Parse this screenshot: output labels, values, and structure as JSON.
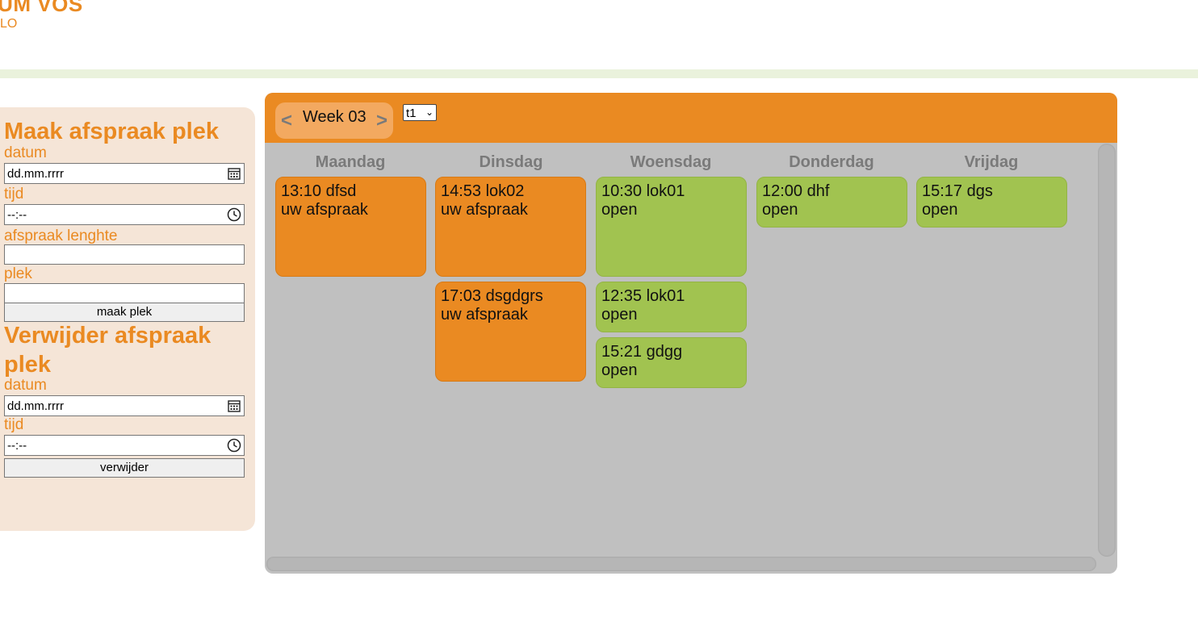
{
  "brand": {
    "title": "CEUM VOS",
    "subtitle": "LO"
  },
  "create_form": {
    "title": "Maak afspraak plek",
    "datum_label": "datum",
    "datum_value": "dd.mm.rrrr",
    "tijd_label": "tijd",
    "tijd_value": "--:--",
    "lengte_label": "afspraak lenghte",
    "lengte_value": "",
    "plek_label": "plek",
    "plek_value": "",
    "submit": "maak plek"
  },
  "delete_form": {
    "title": "Verwijder afspraak plek",
    "datum_label": "datum",
    "datum_value": "dd.mm.rrrr",
    "tijd_label": "tijd",
    "tijd_value": "--:--",
    "submit": "verwijder"
  },
  "calendar": {
    "prev": "<",
    "next": ">",
    "week": "Week 03",
    "selected": "t1",
    "days": [
      "Maandag",
      "Dinsdag",
      "Woensdag",
      "Donderdag",
      "Vrijdag"
    ],
    "appointments": [
      {
        "line1": "13:10 dfsd",
        "line2": "uw afspraak",
        "status": "mine"
      },
      {
        "line1": "14:53 lok02",
        "line2": "uw afspraak",
        "status": "mine"
      },
      {
        "line1": "17:03 dsgdgrs",
        "line2": "uw afspraak",
        "status": "mine"
      },
      {
        "line1": "10:30 lok01",
        "line2": "open",
        "status": "open"
      },
      {
        "line1": "12:35 lok01",
        "line2": "open",
        "status": "open"
      },
      {
        "line1": "15:21 gdgg",
        "line2": "open",
        "status": "open"
      },
      {
        "line1": "12:00 dhf",
        "line2": "open",
        "status": "open"
      },
      {
        "line1": "15:17 dgs",
        "line2": "open",
        "status": "open"
      }
    ]
  },
  "colors": {
    "accent": "#ea8a22",
    "open": "#a1c350",
    "panel": "#f5e5d7",
    "calendar_bg": "#c0c0c0"
  }
}
